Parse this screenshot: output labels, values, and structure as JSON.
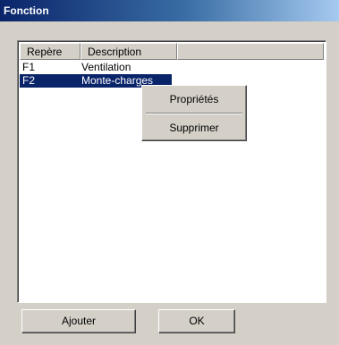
{
  "window": {
    "title": "Fonction"
  },
  "list": {
    "columns": [
      "Repère",
      "Description",
      ""
    ],
    "rows": [
      {
        "repere": "F1",
        "description": "Ventilation",
        "selected": false
      },
      {
        "repere": "F2",
        "description": "Monte-charges",
        "selected": true
      }
    ]
  },
  "context_menu": {
    "items": [
      "Propriétés",
      "Supprimer"
    ]
  },
  "buttons": {
    "add_label": "Ajouter",
    "ok_label": "OK"
  },
  "colors": {
    "title_bar": "#0a246a",
    "selection": "#0a246a",
    "face": "#d4d0c8"
  }
}
